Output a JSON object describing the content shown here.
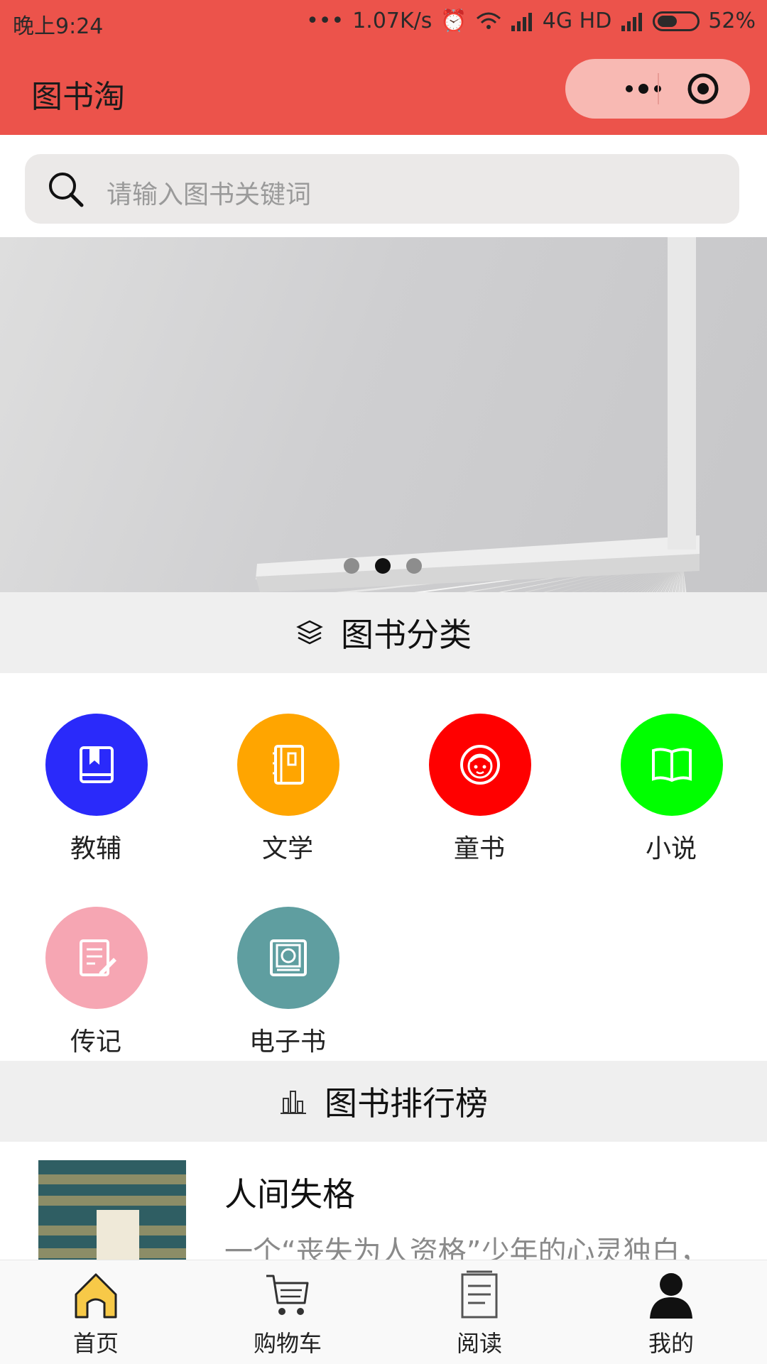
{
  "status": {
    "time": "晚上9:24",
    "network_speed": "1.07K/s",
    "network_type": "4G HD",
    "battery": "52%",
    "battery_level": 0.52
  },
  "nav": {
    "title": "图书淘",
    "capsule": {
      "more_icon": "more-dots-icon",
      "close_icon": "target-icon"
    }
  },
  "search": {
    "placeholder": "请输入图书关键词",
    "icon": "search-icon"
  },
  "banner": {
    "page_count": 3,
    "active_index": 1
  },
  "sections": {
    "categories_title": "图书分类",
    "ranking_title": "图书排行榜"
  },
  "categories": [
    {
      "label": "教辅",
      "color": "#2a2afa",
      "icon": "bookmark-book-icon"
    },
    {
      "label": "文学",
      "color": "#ffa500",
      "icon": "notebook-icon"
    },
    {
      "label": "童书",
      "color": "#ff0000",
      "icon": "child-face-icon"
    },
    {
      "label": "小说",
      "color": "#00ff00",
      "icon": "open-book-icon"
    },
    {
      "label": "传记",
      "color": "#f6a6b3",
      "icon": "edit-document-icon"
    },
    {
      "label": "电子书",
      "color": "#5f9ea0",
      "icon": "ebook-icon"
    }
  ],
  "ranking": [
    {
      "title": "人间失格",
      "desc": "一个“丧失为人资格”少年的心灵独白，"
    }
  ],
  "tabbar": {
    "items": [
      {
        "label": "首页",
        "icon": "home-icon",
        "active": true
      },
      {
        "label": "购物车",
        "icon": "cart-icon",
        "active": false
      },
      {
        "label": "阅读",
        "icon": "document-icon",
        "active": false
      },
      {
        "label": "我的",
        "icon": "user-icon",
        "active": false
      }
    ],
    "active_color": "#f7c948"
  }
}
